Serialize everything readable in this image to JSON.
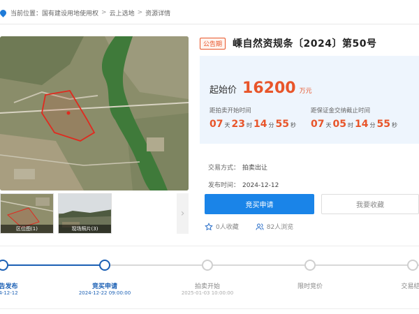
{
  "breadcrumb": {
    "items": [
      "当前位置：",
      "国有建设用地使用权",
      "云上选地",
      "资源详情"
    ],
    "separator": ">"
  },
  "gallery": {
    "thumbnails": [
      {
        "caption": "区位图(1)"
      },
      {
        "caption": "现场照片(3)"
      }
    ],
    "next_icon": "chevron-right-icon"
  },
  "listing": {
    "badge": "公告期",
    "title": "嵊自然资规条〔2024〕第50号",
    "start_price_label": "起始价",
    "start_price_value": "16200",
    "start_price_unit": "万元",
    "countdown_auction": {
      "label": "距拍卖开始时间",
      "days": "07",
      "day_unit": "天",
      "hours": "23",
      "hour_unit": "时",
      "minutes": "14",
      "minute_unit": "分",
      "seconds": "55",
      "second_unit": "秒"
    },
    "countdown_deposit": {
      "label": "距保证金交纳截止时间",
      "days": "07",
      "day_unit": "天",
      "hours": "05",
      "hour_unit": "时",
      "minutes": "14",
      "minute_unit": "分",
      "seconds": "55",
      "second_unit": "秒"
    },
    "trade_method_label": "交易方式：",
    "trade_method_value": "拍卖出让",
    "publish_time_label": "发布时间：",
    "publish_time_value": "2024-12-12"
  },
  "actions": {
    "apply_label": "竞买申请",
    "favorite_label": "我要收藏"
  },
  "stats": {
    "favorites": "0人收藏",
    "views": "82人浏览"
  },
  "timeline": {
    "steps": [
      {
        "label": "告发布",
        "date": "4-12-12",
        "active": true
      },
      {
        "label": "竞买申请",
        "date": "2024-12-22 09:00:00",
        "active": true
      },
      {
        "label": "拍卖开始",
        "date": "2025-01-03 10:00:00",
        "active": false
      },
      {
        "label": "限时竞价",
        "date": "",
        "active": false
      },
      {
        "label": "交易结",
        "date": "",
        "active": false
      }
    ]
  },
  "colors": {
    "accent_blue": "#1a84e8",
    "timeline_blue": "#1a5fb4",
    "price_orange": "#e8552a",
    "panel_bg": "#eef5fd"
  }
}
